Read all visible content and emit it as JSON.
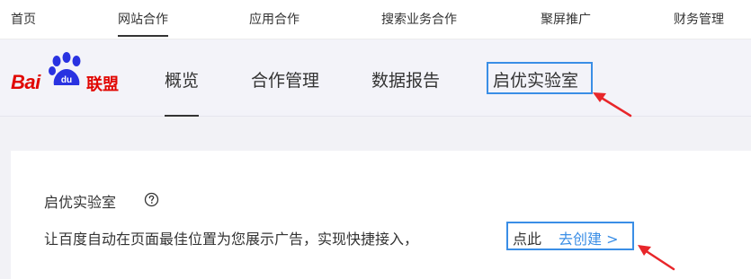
{
  "top_nav": {
    "items": [
      {
        "label": "首页"
      },
      {
        "label": "网站合作"
      },
      {
        "label": "应用合作"
      },
      {
        "label": "搜索业务合作"
      },
      {
        "label": "聚屏推广"
      },
      {
        "label": "财务管理"
      }
    ]
  },
  "logo": {
    "bai": "Bai",
    "du": "du",
    "union": "联盟"
  },
  "product_tabs": [
    {
      "label": "概览"
    },
    {
      "label": "合作管理"
    },
    {
      "label": "数据报告"
    },
    {
      "label": "启优实验室"
    }
  ],
  "card": {
    "title": "启优实验室",
    "description": "让百度自动在页面最佳位置为您展示广告，实现快捷接入，",
    "cta_prefix": "点此",
    "cta_link": "去创建 >"
  },
  "icons": {
    "help": "question-circle-icon",
    "annotation": "red-arrow-icon"
  },
  "colors": {
    "brand_red": "#e10601",
    "baidu_blue": "#2932e1",
    "link_blue": "#3a8ee6",
    "highlight_border": "#3a8ee6",
    "arrow_red": "#e8262a"
  }
}
